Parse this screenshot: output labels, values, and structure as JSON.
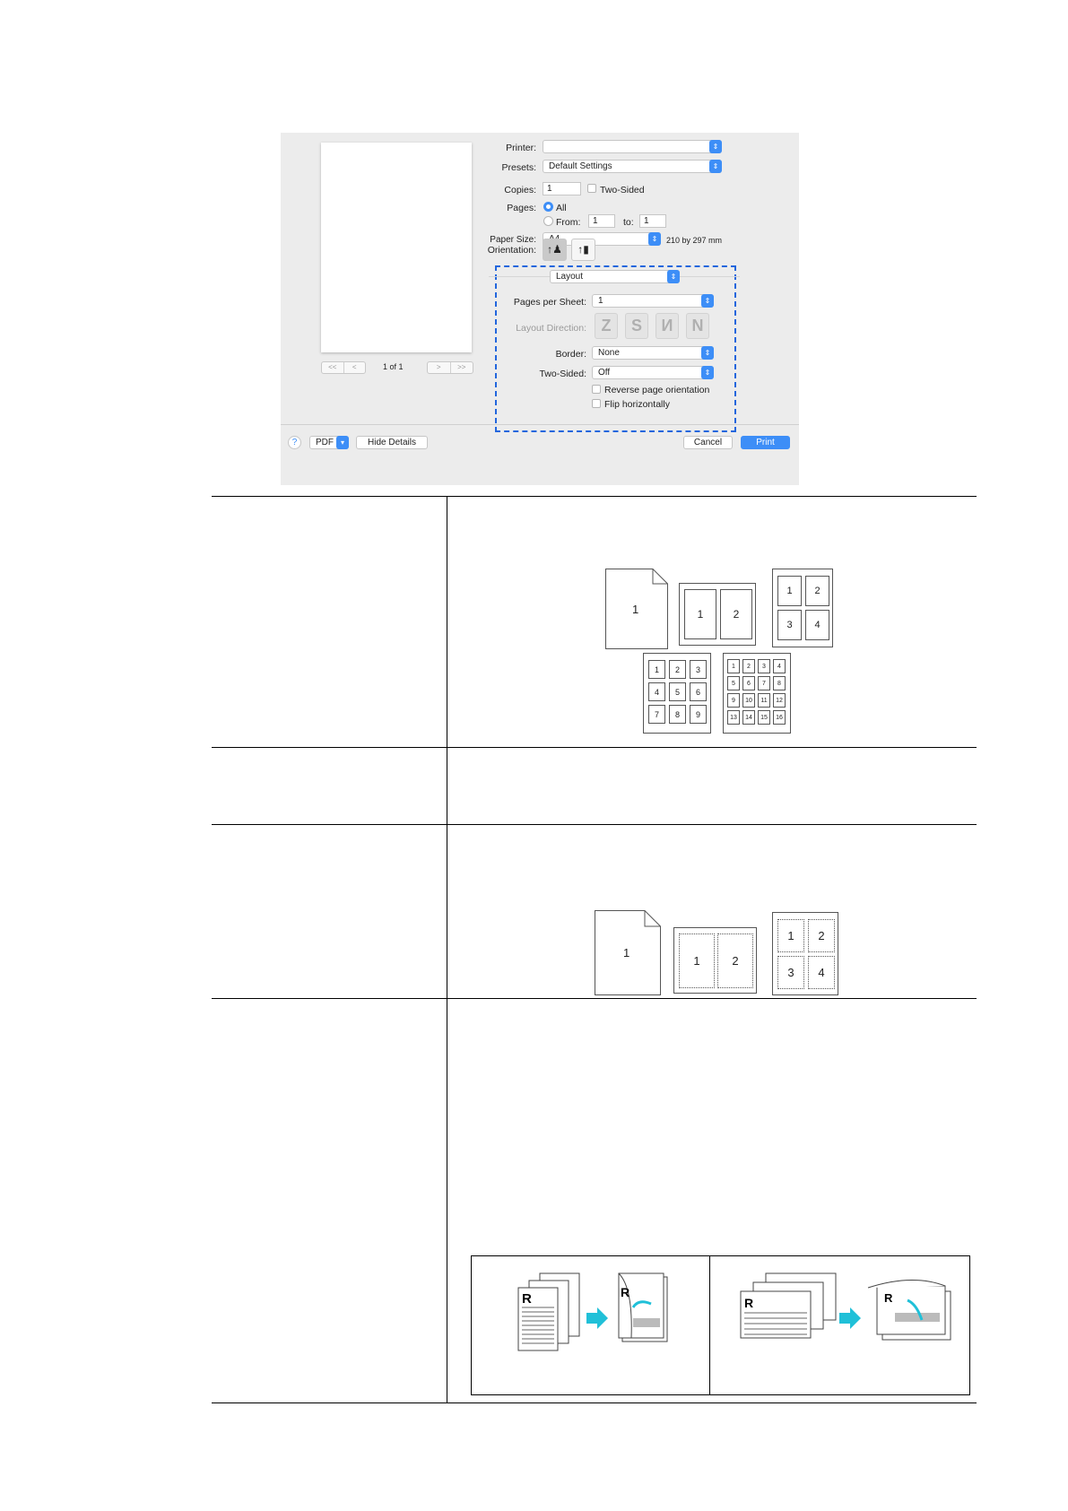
{
  "dialog": {
    "preview": {
      "page_indicator": "1 of 1",
      "first": "<<",
      "prev": "<",
      "next": ">",
      "last": ">>"
    },
    "printer": {
      "label": "Printer:",
      "value": ""
    },
    "presets": {
      "label": "Presets:",
      "value": "Default Settings"
    },
    "copies": {
      "label": "Copies:",
      "value": "1",
      "two_sided_label": "Two-Sided",
      "two_sided_checked": false
    },
    "pages": {
      "label": "Pages:",
      "all_label": "All",
      "from_label": "From:",
      "from_value": "1",
      "to_label": "to:",
      "to_value": "1",
      "selected": "All"
    },
    "paper_size": {
      "label": "Paper Size:",
      "value": "A4",
      "dimensions": "210 by 297 mm"
    },
    "orientation": {
      "label": "Orientation:",
      "selected": "portrait",
      "icons": [
        "portrait-icon",
        "landscape-icon"
      ]
    },
    "section_popup": "Layout",
    "layout": {
      "pages_per_sheet": {
        "label": "Pages per Sheet:",
        "value": "1"
      },
      "layout_direction": {
        "label": "Layout Direction:",
        "enabled": false,
        "options": [
          "Z",
          "S",
          "И",
          "N"
        ]
      },
      "border": {
        "label": "Border:",
        "value": "None"
      },
      "two_sided": {
        "label": "Two-Sided:",
        "value": "Off"
      },
      "reverse_orientation": {
        "label": "Reverse page orientation",
        "checked": false
      },
      "flip_horizontally": {
        "label": "Flip horizontally",
        "checked": false
      }
    },
    "footer": {
      "help": "?",
      "pdf": "PDF",
      "hide_details": "Hide Details",
      "cancel": "Cancel",
      "print": "Print"
    },
    "colors": {
      "accent": "#3d8ef7",
      "highlight": "#2266dd"
    }
  },
  "diagrams": {
    "pages_per_sheet": {
      "one": "1",
      "two": [
        "1",
        "2"
      ],
      "four": [
        "1",
        "2",
        "3",
        "4"
      ],
      "nine": [
        "1",
        "2",
        "3",
        "4",
        "5",
        "6",
        "7",
        "8",
        "9"
      ],
      "sixteen": [
        "1",
        "2",
        "3",
        "4",
        "5",
        "6",
        "7",
        "8",
        "9",
        "10",
        "11",
        "12",
        "13",
        "14",
        "15",
        "16"
      ]
    },
    "border": {
      "one": "1",
      "two": [
        "1",
        "2"
      ],
      "four": [
        "1",
        "2",
        "3",
        "4"
      ]
    },
    "two_sided": {
      "letter": "R"
    }
  }
}
